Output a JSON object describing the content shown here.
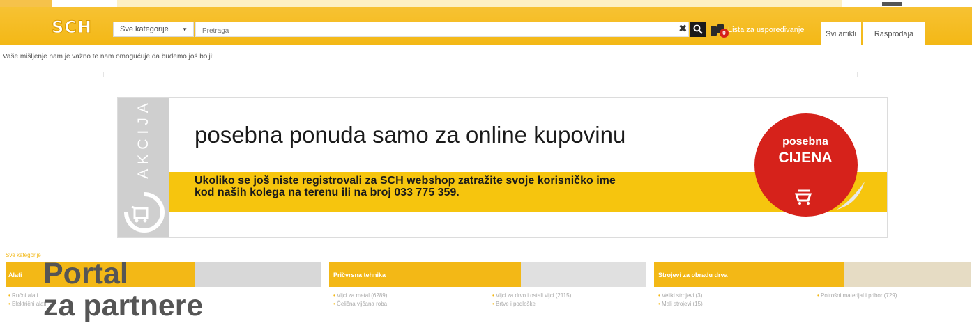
{
  "header": {
    "logo_text": "SCH",
    "category_select": "Sve kategorije",
    "search_placeholder": "Pretraga",
    "compare_count": "0",
    "compare_link": "Lista za usporedivanje",
    "tabs": [
      {
        "label": "Svi artikli"
      },
      {
        "label": "Rasprodaja"
      }
    ]
  },
  "feedback_text": "Vaše mišljenje nam je važno te nam omogućuje da budemo još bolji!",
  "banner": {
    "side_label": "AKCIJA",
    "headline": "posebna ponuda samo za online kupovinu",
    "band_line1": "Ukoliko se još niste registrovali za SCH webshop zatražite svoje korisničko ime",
    "band_line2": "kod naših kolega na terenu ili na broj 033 775 359.",
    "sticker_line1": "posebna",
    "sticker_line2": "CIJENA"
  },
  "categories": {
    "section_label": "Sve kategorije",
    "items": [
      {
        "title": "Alati",
        "sub": [
          "Ručni alati",
          "Električni alati"
        ]
      },
      {
        "title": "Pričvrsna tehnika",
        "sub": [
          "Vijci za metal (6289)",
          "Čelična vijčana roba",
          "Vijci za drvo i ostali vijci (2115)",
          "Brtve i podloške"
        ]
      },
      {
        "title": "Strojevi za obradu drva",
        "sub": [
          "Veliki strojevi (3)",
          "Mali strojevi (15)",
          "Potrošni materijal i pribor (729)"
        ]
      }
    ]
  },
  "overlay_title_line1": "Portal",
  "overlay_title_line2": "za partnere",
  "colors": {
    "brand_yellow": "#f3b816",
    "sticker_red": "#d6221b",
    "band_yellow": "#f6c50e"
  }
}
